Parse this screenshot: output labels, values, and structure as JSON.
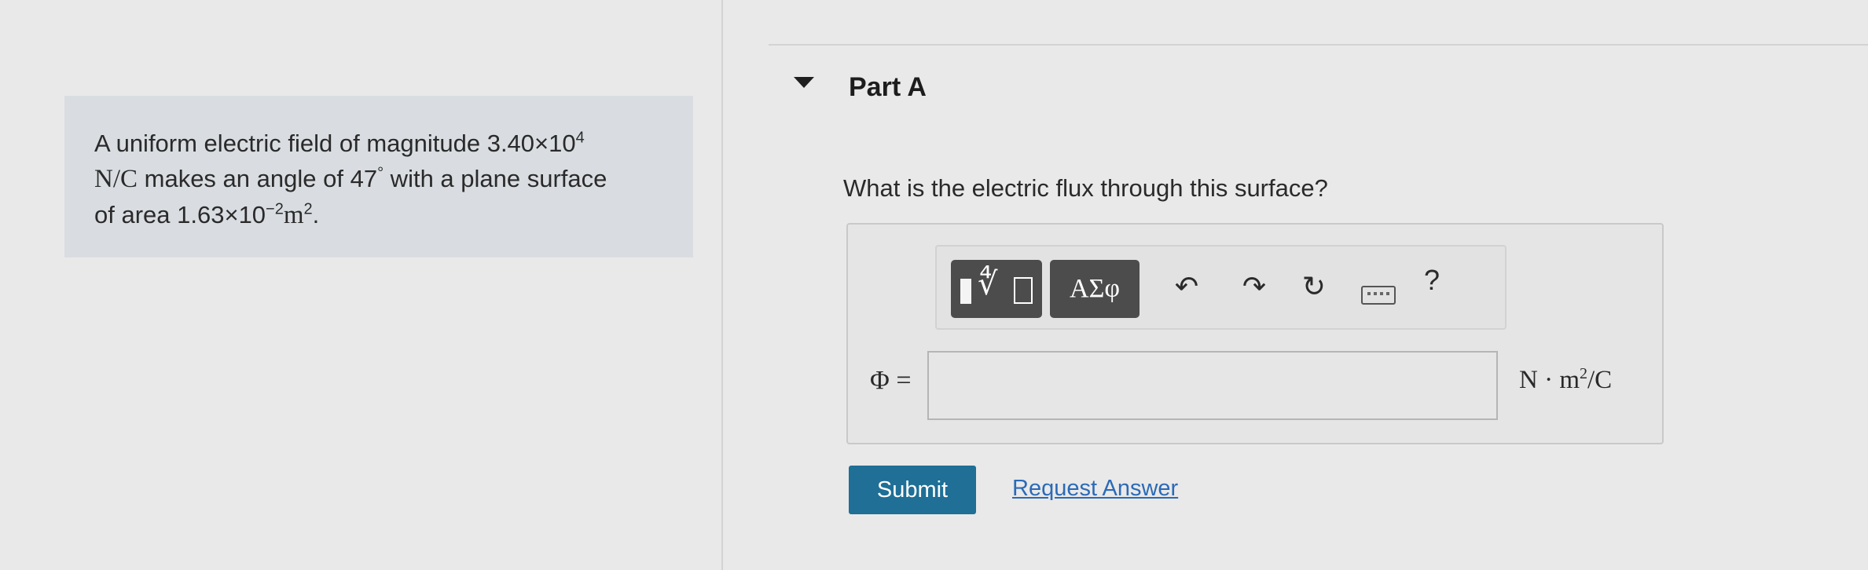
{
  "problem": {
    "text_before": "A uniform electric field of magnitude ",
    "magnitude_mantissa": "3.40×10",
    "magnitude_exponent": "4",
    "field_unit": "N/C",
    "text_angle": " makes an angle of ",
    "angle_value": "47",
    "degree_symbol": "°",
    "text_surface": " with a plane surface",
    "text_area": "of area ",
    "area_mantissa": "1.63×10",
    "area_exponent": "−2",
    "area_unit_base": "m",
    "area_unit_exponent": "2",
    "period": "."
  },
  "part": {
    "title": "Part A",
    "question": "What is the electric flux through this surface?"
  },
  "toolbar": {
    "templates_icon": "templates-icon",
    "symbols_label": "ΑΣφ",
    "undo_glyph": "↶",
    "redo_glyph": "↷",
    "reset_glyph": "↻",
    "keyboard_icon": "keyboard-icon",
    "help_label": "?"
  },
  "answer": {
    "variable": "Φ",
    "equals": " =",
    "value": "",
    "units_base": "N · m",
    "units_exponent": "2",
    "units_tail": "/C"
  },
  "actions": {
    "submit_label": "Submit",
    "request_label": "Request Answer"
  },
  "colors": {
    "submit_bg": "#1f6f96",
    "link": "#2b6ab7",
    "toolbar_button": "#4c4c4c"
  }
}
